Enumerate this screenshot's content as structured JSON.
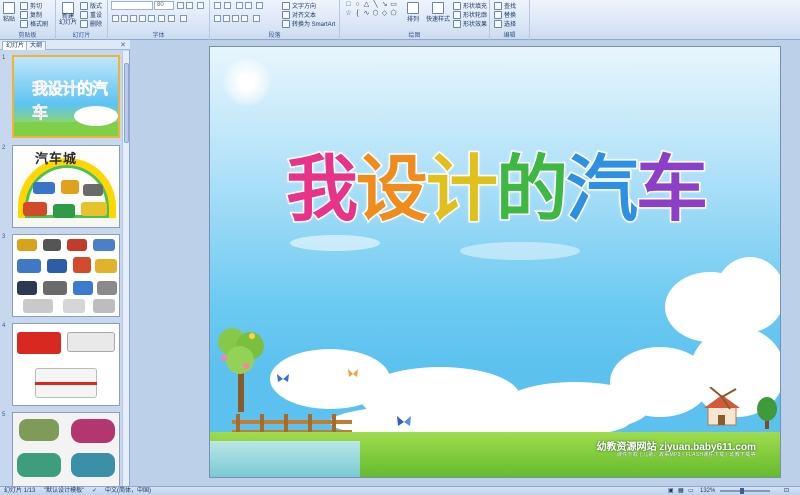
{
  "ribbon": {
    "clipboard": {
      "paste_label": "粘贴",
      "cut_label": "剪切",
      "copy_label": "复制",
      "format_painter_label": "格式刷",
      "group_label": "剪贴板"
    },
    "slides": {
      "new_slide_label": "新建\n幻灯片",
      "layout_label": "版式",
      "reset_label": "重设",
      "delete_label": "删除",
      "group_label": "幻灯片"
    },
    "font": {
      "font_size": "80",
      "group_label": "字体"
    },
    "paragraph": {
      "text_direction_label": "文字方向",
      "align_text_label": "对齐文本",
      "smartart_label": "转换为 SmartArt",
      "group_label": "段落"
    },
    "drawing": {
      "arrange_label": "排列",
      "quick_styles_label": "快速样式",
      "shape_fill_label": "形状填充",
      "shape_outline_label": "形状轮廓",
      "shape_effects_label": "形状效果",
      "group_label": "绘图"
    },
    "editing": {
      "find_label": "查找",
      "replace_label": "替换",
      "select_label": "选择",
      "group_label": "编辑"
    }
  },
  "panel": {
    "tabs": [
      {
        "label": "幻灯片"
      },
      {
        "label": "大纲"
      }
    ],
    "slides": [
      {
        "number": "1",
        "title": "我设计的汽车"
      },
      {
        "number": "2",
        "title": "汽车城"
      },
      {
        "number": "3"
      },
      {
        "number": "4"
      },
      {
        "number": "5"
      }
    ]
  },
  "slide": {
    "title_chars": [
      "我",
      "设",
      "计",
      "的",
      "汽",
      "车"
    ],
    "watermark_site": "幼教资源网站  ziyuan.baby611.com",
    "watermark_sub": "课件下载  |  儿歌、故事MP3  |  FLASH课件下载  |  幼教下载等"
  },
  "colors": {
    "title": [
      "#e8338a",
      "#f08c1c",
      "#f4d21b",
      "#3fb843",
      "#2f8fe0",
      "#8c3fc7"
    ],
    "accent": "#f0b433"
  },
  "status_bar": {
    "slide_indicator": "幻灯片 1/13",
    "theme": "\"默认设计模板\"",
    "language": "中文(简体，中国)",
    "zoom": "132%"
  }
}
